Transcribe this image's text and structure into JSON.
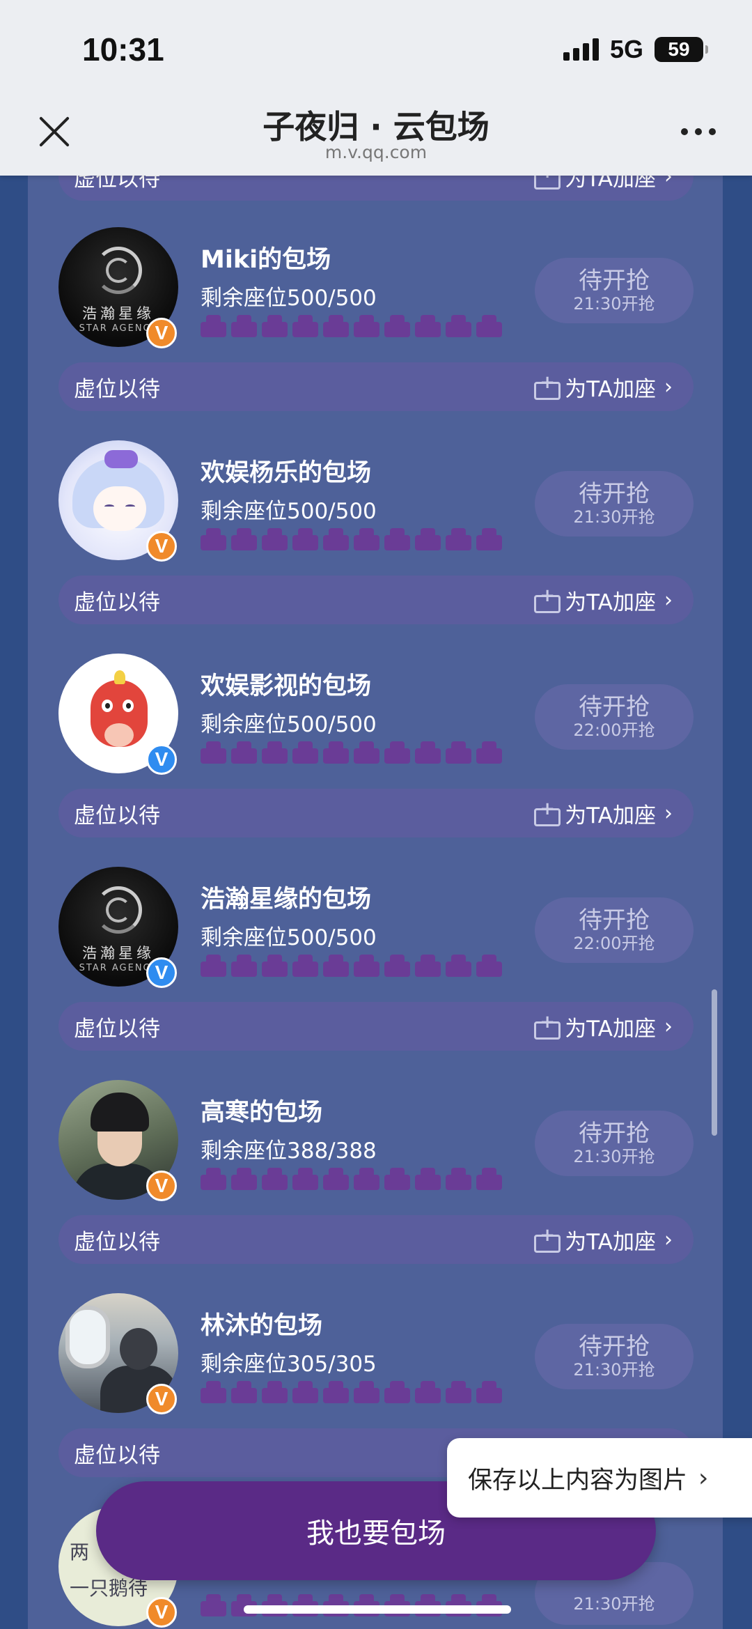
{
  "status": {
    "time": "10:31",
    "network": "5G",
    "battery": "59"
  },
  "nav": {
    "title": "子夜归 · 云包场",
    "subtitle": "m.v.qq.com"
  },
  "wait_label": "虚位以待",
  "add_seat_label": "为TA加座",
  "pill_main": "待开抢",
  "top_partial": {
    "wait": "虚位以待",
    "add": "为TA加座"
  },
  "cards": [
    {
      "title": "Miki的包场",
      "seats": "剩余座位500/500",
      "status": "待开抢",
      "time": "21:30开抢",
      "badge": "V",
      "avatar_icon": "star-agency-logo",
      "avatar_text": "浩瀚星缘",
      "avatar_text2": "STAR AGENCY"
    },
    {
      "title": "欢娱杨乐的包场",
      "seats": "剩余座位500/500",
      "status": "待开抢",
      "time": "21:30开抢",
      "badge": "V",
      "avatar_icon": "anime-girl-avatar"
    },
    {
      "title": "欢娱影视的包场",
      "seats": "剩余座位500/500",
      "status": "待开抢",
      "time": "22:00开抢",
      "badge": "V",
      "avatar_icon": "red-dragon-mascot"
    },
    {
      "title": "浩瀚星缘的包场",
      "seats": "剩余座位500/500",
      "status": "待开抢",
      "time": "22:00开抢",
      "badge": "V",
      "avatar_icon": "star-agency-logo",
      "avatar_text": "浩瀚星缘",
      "avatar_text2": "STAR AGENCY"
    },
    {
      "title": "高寒的包场",
      "seats": "剩余座位388/388",
      "status": "待开抢",
      "time": "21:30开抢",
      "badge": "V",
      "avatar_icon": "man-portrait"
    },
    {
      "title": "林沐的包场",
      "seats": "剩余座位305/305",
      "status": "待开抢",
      "time": "21:30开抢",
      "badge": "V",
      "avatar_icon": "plane-portrait"
    }
  ],
  "last_card": {
    "avatar_line1": "两",
    "avatar_line2": "一只鹅待",
    "time": "21:30开抢",
    "badge": "V"
  },
  "fab_label": "我也要包场",
  "save_label": "保存以上内容为图片",
  "colors": {
    "panel": "#4e6199",
    "bar": "#5b5d9e",
    "seat": "#6a3c96",
    "fab": "#5a2a86",
    "badge_orange": "#f08a2a",
    "badge_blue": "#2f8cf0"
  }
}
